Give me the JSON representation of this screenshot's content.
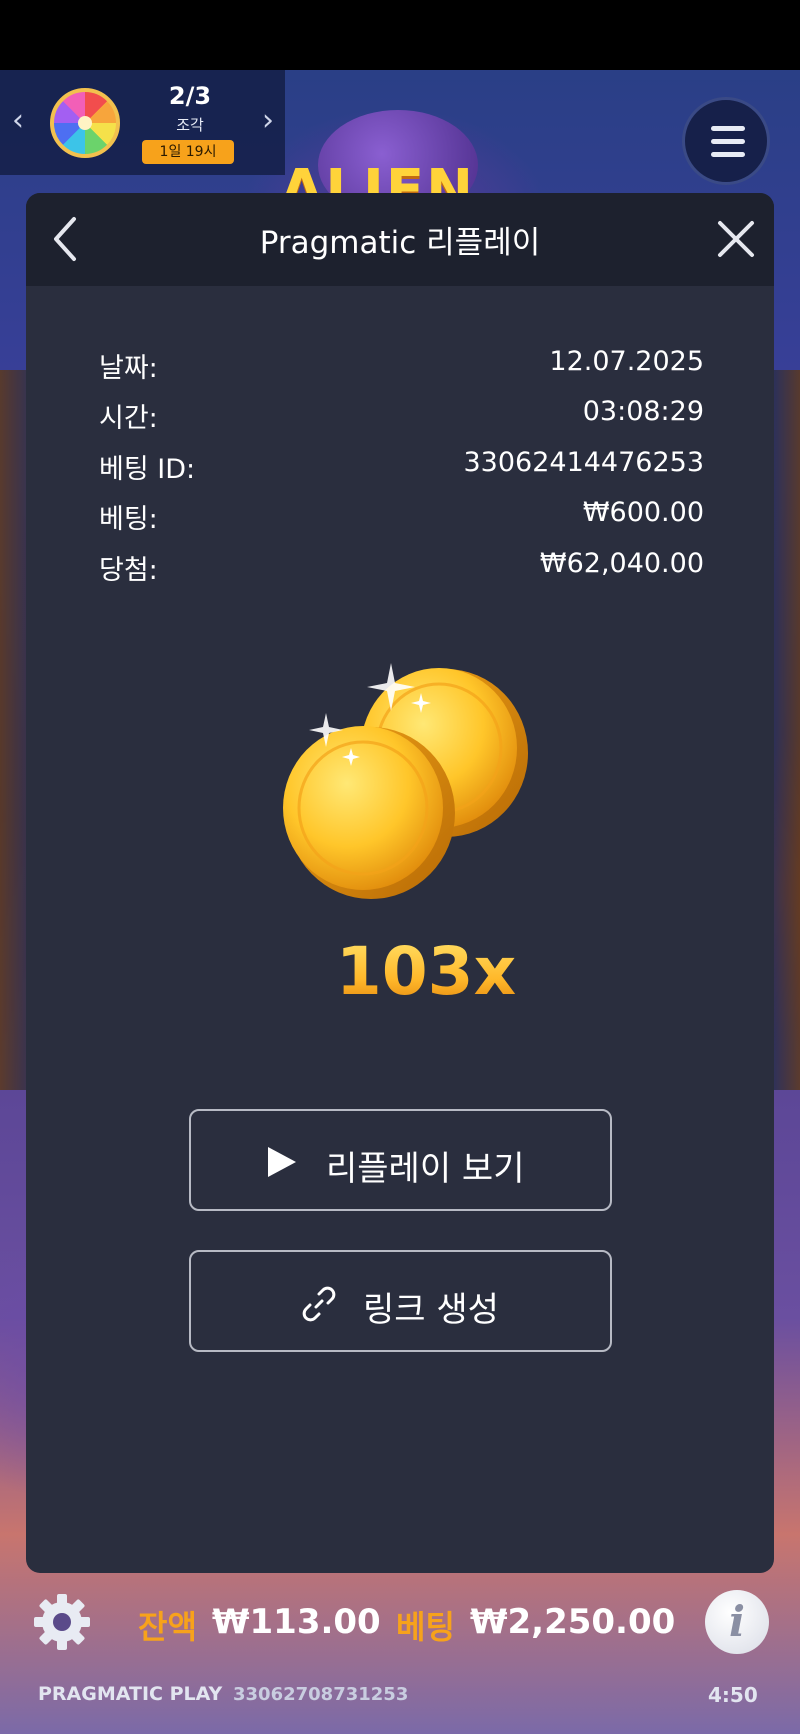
{
  "event_widget": {
    "count": "2/3",
    "unit": "조각",
    "timer": "1일 19시",
    "prev_icon": "chevron-left-icon",
    "next_icon": "chevron-right-icon",
    "wheel_icon": "prize-wheel-icon"
  },
  "game": {
    "logo_text": "ALIEN"
  },
  "modal": {
    "title": "Pragmatic 리플레이",
    "back_icon": "chevron-left-icon",
    "close_icon": "close-icon",
    "details": [
      {
        "label": "날짜:",
        "value": "12.07.2025"
      },
      {
        "label": "시간:",
        "value": "03:08:29"
      },
      {
        "label": "베팅 ID:",
        "value": "33062414476253"
      },
      {
        "label": "베팅:",
        "value": "₩600.00"
      },
      {
        "label": "당첨:",
        "value": "₩62,040.00"
      }
    ],
    "multiplier": "103x",
    "buttons": {
      "watch_replay": "리플레이 보기",
      "create_link": "링크 생성"
    }
  },
  "bottom_bar": {
    "balance_label": "잔액",
    "balance_value": "₩113.00",
    "bet_label": "베팅",
    "bet_value": "₩2,250.00",
    "info_glyph": "i"
  },
  "footer": {
    "brand": "PRAGMATIC PLAY",
    "session_id": "33062708731253",
    "clock": "4:50"
  },
  "colors": {
    "accent": "#f7a21b",
    "modal_bg": "#2a2e3e",
    "modal_header_bg": "#1d212e",
    "gold": "#ffc02e"
  }
}
